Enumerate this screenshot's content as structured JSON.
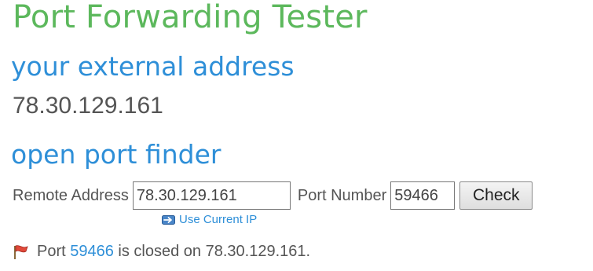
{
  "header": {
    "title": "Port Forwarding Tester"
  },
  "external": {
    "heading": "your external address",
    "ip": "78.30.129.161"
  },
  "finder": {
    "heading": "open port finder",
    "remote_label": "Remote Address",
    "remote_value": "78.30.129.161",
    "port_label": "Port Number",
    "port_value": "59466",
    "check_label": "Check",
    "use_current_ip": "Use Current IP"
  },
  "result": {
    "icon": "red-flag-icon",
    "prefix": "Port ",
    "port": "59466",
    "middle": " is closed on ",
    "host": "78.30.129.161",
    "suffix": "."
  },
  "colors": {
    "title": "#5cb85c",
    "heading": "#2e8fd8",
    "link": "#2e8fd8",
    "text": "#555555"
  }
}
